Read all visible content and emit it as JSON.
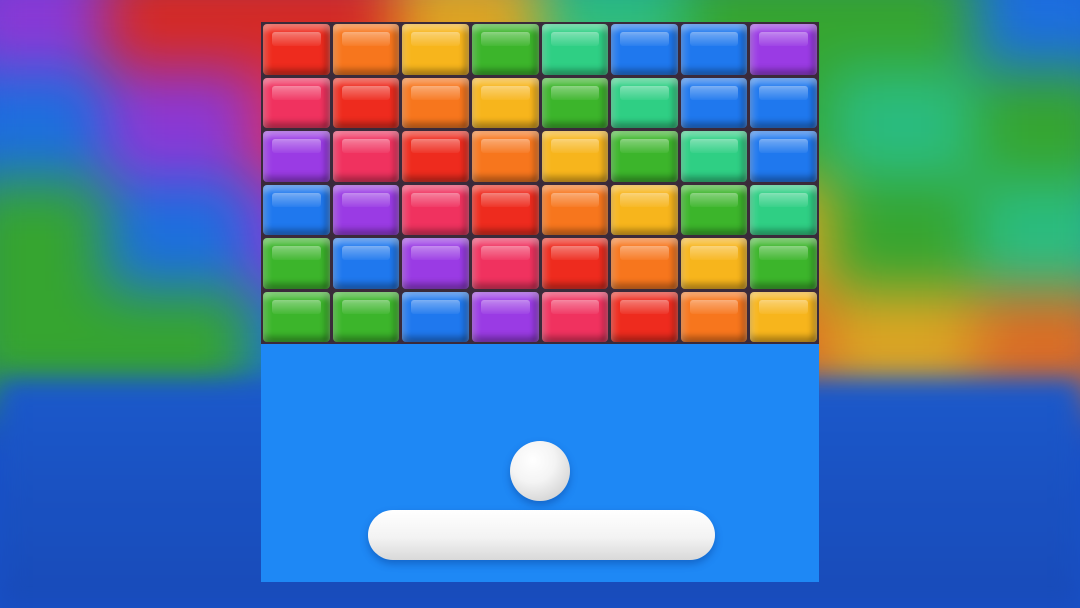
{
  "game": {
    "name": "brick-breaker",
    "board_color": "#1e88f5",
    "colors": {
      "red": "#ee2b1e",
      "orange": "#f7761d",
      "yellow": "#f7b51c",
      "green": "#3cb52b",
      "teal": "#2fcf84",
      "blue": "#1f78ee",
      "purple": "#9a3be4",
      "pink": "#f0325f"
    },
    "bricks": [
      [
        "red",
        "orange",
        "yellow",
        "green",
        "teal",
        "blue",
        "blue",
        "purple"
      ],
      [
        "pink",
        "red",
        "orange",
        "yellow",
        "green",
        "teal",
        "blue",
        "blue"
      ],
      [
        "purple",
        "pink",
        "red",
        "orange",
        "yellow",
        "green",
        "teal",
        "blue"
      ],
      [
        "blue",
        "purple",
        "pink",
        "red",
        "orange",
        "yellow",
        "green",
        "teal"
      ],
      [
        "green",
        "blue",
        "purple",
        "pink",
        "red",
        "orange",
        "yellow",
        "green"
      ],
      [
        "green",
        "green",
        "blue",
        "purple",
        "pink",
        "red",
        "orange",
        "yellow"
      ]
    ],
    "backdrop_bricks": [
      [
        "purple",
        "red",
        "red",
        "yellow",
        "teal",
        "green",
        "green",
        "blue"
      ],
      [
        "blue",
        "purple",
        "pink",
        "orange",
        "yellow",
        "green",
        "teal",
        "green"
      ],
      [
        "green",
        "blue",
        "purple",
        "red",
        "orange",
        "yellow",
        "green",
        "teal"
      ],
      [
        "green",
        "green",
        "blue",
        "pink",
        "red",
        "orange",
        "yellow",
        "orange"
      ]
    ],
    "ball": {
      "color": "#f2f2f2"
    },
    "paddle": {
      "color": "#f2f2f2"
    }
  }
}
